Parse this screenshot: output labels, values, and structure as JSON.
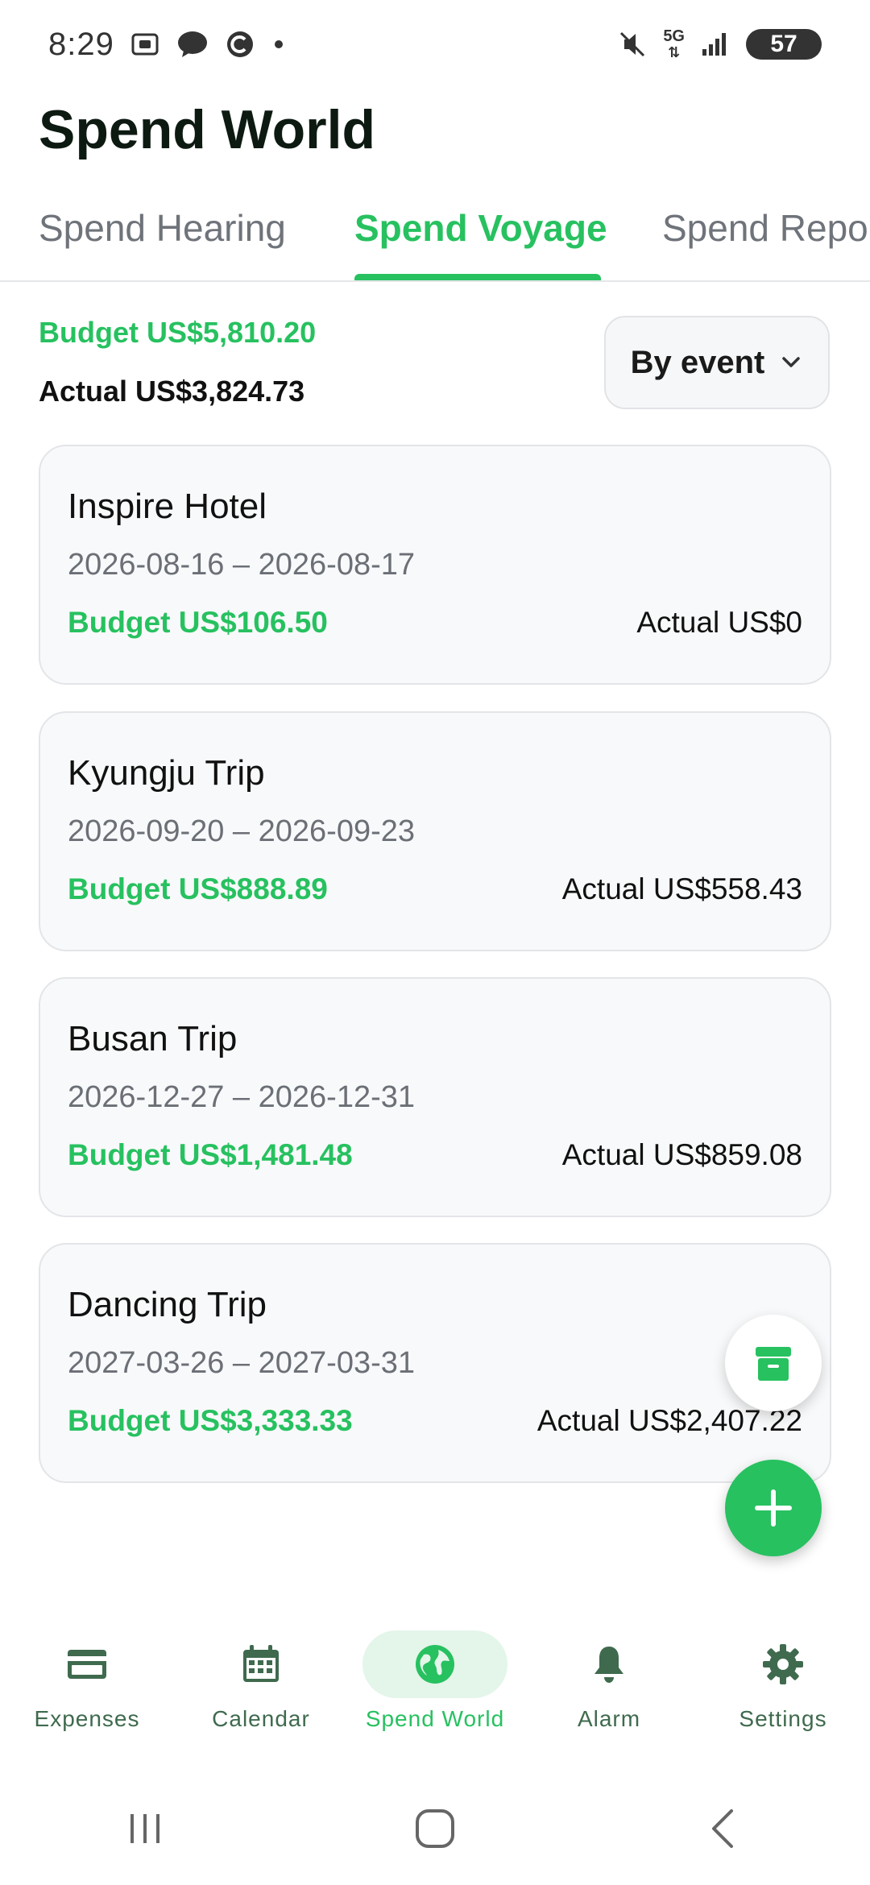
{
  "status_bar": {
    "time": "8:29",
    "battery": "57",
    "network": "5G"
  },
  "app": {
    "title": "Spend World"
  },
  "tabs": [
    {
      "label": "Spend Hearing",
      "active": false
    },
    {
      "label": "Spend Voyage",
      "active": true
    },
    {
      "label": "Spend Repo",
      "active": false
    }
  ],
  "summary": {
    "budget": "Budget US$5,810.20",
    "actual": "Actual US$3,824.73",
    "filter": "By event"
  },
  "events": [
    {
      "title": "Inspire Hotel",
      "dates": "2026-08-16 – 2026-08-17",
      "budget": "Budget US$106.50",
      "actual": "Actual US$0"
    },
    {
      "title": "Kyungju Trip",
      "dates": "2026-09-20 – 2026-09-23",
      "budget": "Budget US$888.89",
      "actual": "Actual US$558.43"
    },
    {
      "title": "Busan Trip",
      "dates": "2026-12-27 – 2026-12-31",
      "budget": "Budget US$1,481.48",
      "actual": "Actual US$859.08"
    },
    {
      "title": "Dancing Trip",
      "dates": "2027-03-26 – 2027-03-31",
      "budget": "Budget US$3,333.33",
      "actual": "Actual US$2,407.22"
    }
  ],
  "bottom_nav": [
    {
      "label": "Expenses",
      "icon": "credit-card-icon",
      "active": false
    },
    {
      "label": "Calendar",
      "icon": "calendar-icon",
      "active": false
    },
    {
      "label": "Spend World",
      "icon": "globe-icon",
      "active": true
    },
    {
      "label": "Alarm",
      "icon": "bell-icon",
      "active": false
    },
    {
      "label": "Settings",
      "icon": "gear-icon",
      "active": false
    }
  ],
  "colors": {
    "accent": "#27c160",
    "nav_icon": "#3f6a4e",
    "nav_active_bg": "#e4f5e9"
  }
}
